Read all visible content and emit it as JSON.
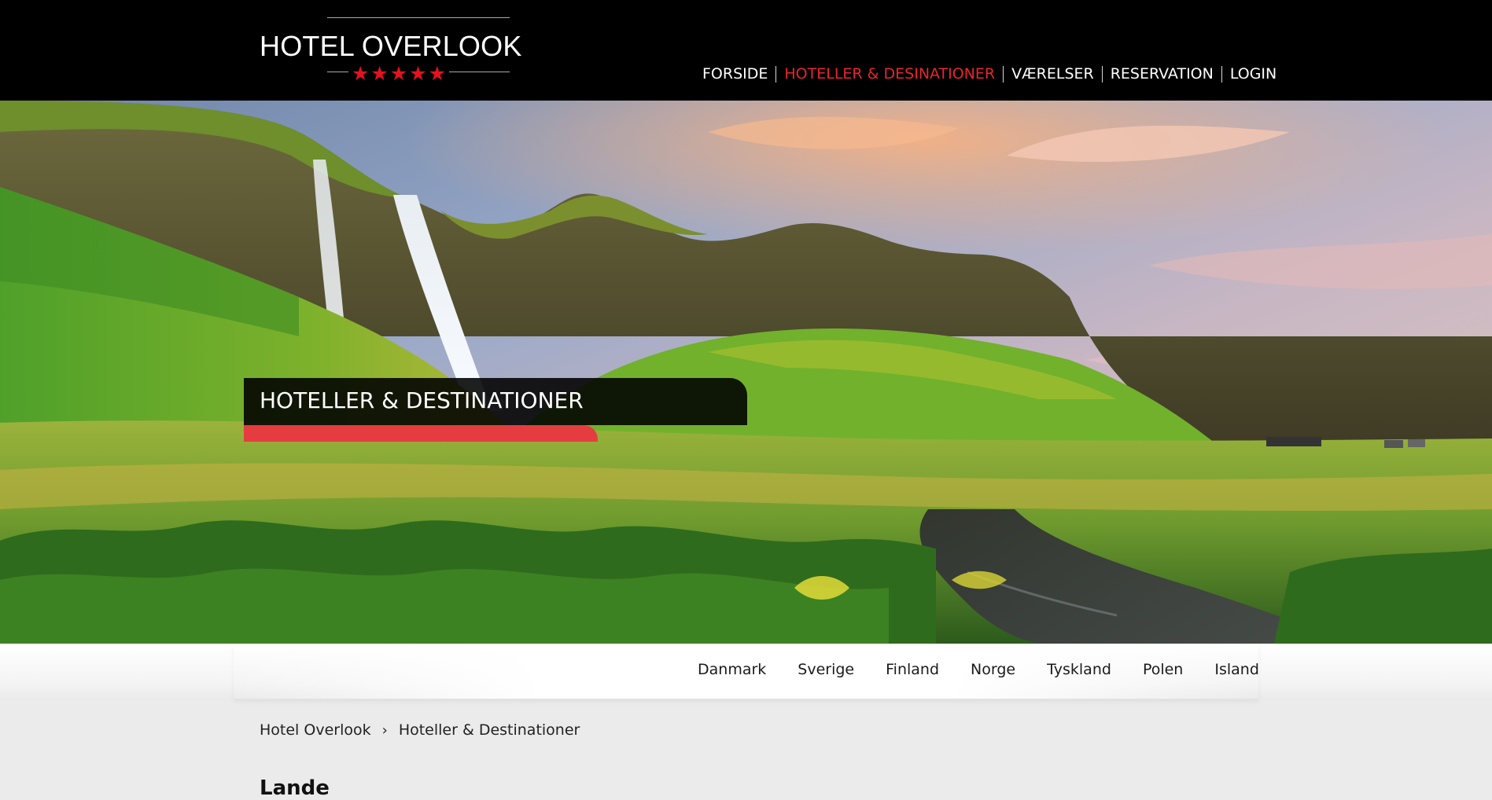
{
  "brand": {
    "name": "HOTEL OVERLOOK",
    "stars": 5,
    "accent_color": "#e3121d"
  },
  "nav": {
    "items": [
      {
        "label": "FORSIDE",
        "active": false
      },
      {
        "label": "HOTELLER & DESINATIONER",
        "active": true
      },
      {
        "label": "VÆRELSER",
        "active": false
      },
      {
        "label": "RESERVATION",
        "active": false
      },
      {
        "label": "LOGIN",
        "active": false
      }
    ],
    "active_color": "#e8262c"
  },
  "hero": {
    "title": "HOTELLER & DESTINATIONER"
  },
  "countries": [
    "Danmark",
    "Sverige",
    "Finland",
    "Norge",
    "Tyskland",
    "Polen",
    "Island"
  ],
  "breadcrumb": {
    "items": [
      "Hotel Overlook",
      "Hoteller & Destinationer"
    ]
  },
  "section": {
    "heading": "Lande"
  }
}
